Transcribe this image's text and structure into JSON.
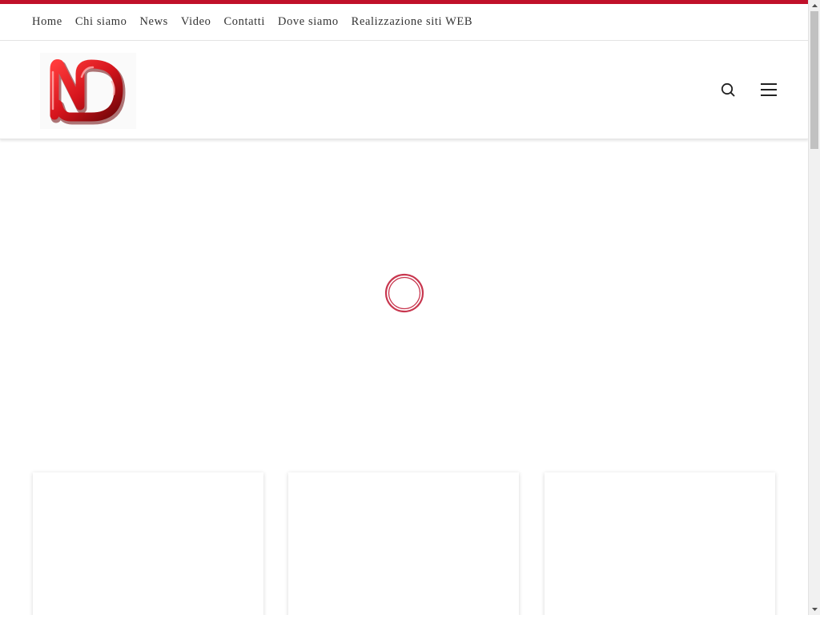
{
  "top_nav": {
    "items": [
      {
        "label": "Home"
      },
      {
        "label": "Chi siamo"
      },
      {
        "label": "News"
      },
      {
        "label": "Video"
      },
      {
        "label": "Contatti"
      },
      {
        "label": "Dove siamo"
      },
      {
        "label": "Realizzazione siti WEB"
      }
    ]
  },
  "header": {
    "logo": {
      "text": "ND",
      "icon": "nd-logo"
    },
    "search_icon": "search-icon",
    "menu_icon": "hamburger-menu-icon"
  },
  "loader": {
    "icon": "loading-spinner"
  },
  "cards_count_visible": 3,
  "colors": {
    "accent": "#c0102a",
    "nav_text": "#333333",
    "spinner": "#c8374f",
    "logo_red": "#d4141c",
    "logo_dark": "#6e0508"
  }
}
